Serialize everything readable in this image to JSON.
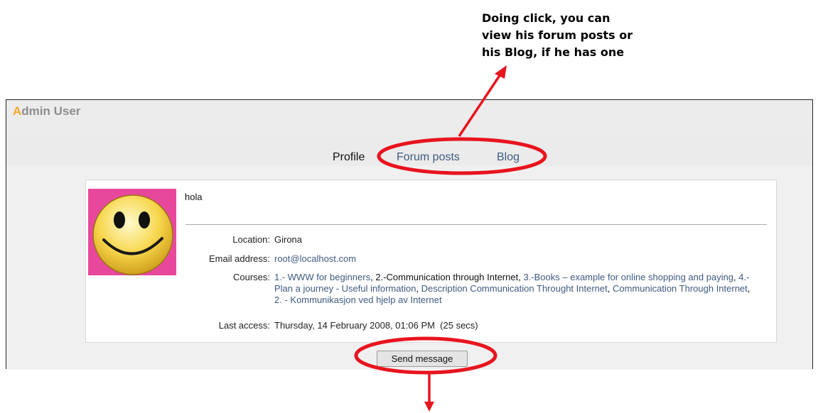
{
  "annotations": {
    "tabs_note": [
      "Doing click, you can",
      "view his forum posts or",
      "his Blog, if he has one"
    ]
  },
  "header": {
    "title_first_letter": "A",
    "title_rest": "dmin User"
  },
  "tabs": [
    {
      "label": "Profile",
      "active": true
    },
    {
      "label": "Forum posts",
      "active": false
    },
    {
      "label": "Blog",
      "active": false
    }
  ],
  "profile": {
    "avatar_icon": "smiley-face-icon",
    "description": "hola",
    "location_label": "Location:",
    "location_value": "Girona",
    "email_label": "Email address:",
    "email_value": "root@localhost.com",
    "courses_label": "Courses:",
    "courses": [
      {
        "text": "1.- WWW for beginners",
        "link": true
      },
      {
        "text": ", ",
        "link": false
      },
      {
        "text": "2.-Communication through Internet",
        "link": false
      },
      {
        "text": ", ",
        "link": false
      },
      {
        "text": "3.-Books – example for online shopping and paying",
        "link": true
      },
      {
        "text": ", ",
        "link": false
      },
      {
        "text": "4.- Plan a journey - Useful information",
        "link": true
      },
      {
        "text": ", ",
        "link": false
      },
      {
        "text": "Description Communication Throught Internet",
        "link": true
      },
      {
        "text": ", ",
        "link": false
      },
      {
        "text": "Communication Through Internet",
        "link": true
      },
      {
        "text": ", ",
        "link": false
      },
      {
        "text": "2. - Kommunikasjon ved hjelp av Internet",
        "link": true
      }
    ],
    "last_access_label": "Last access:",
    "last_access_value": "Thursday, 14 February 2008, 01:06 PM  (25 secs)"
  },
  "send_message_label": "Send message",
  "colors": {
    "link": "#3f5a80",
    "highlight_ellipse": "#e8141e",
    "title_accent": "#f4a825",
    "title_gray": "#8d8d8d",
    "avatar_bg": "#e8489c"
  }
}
